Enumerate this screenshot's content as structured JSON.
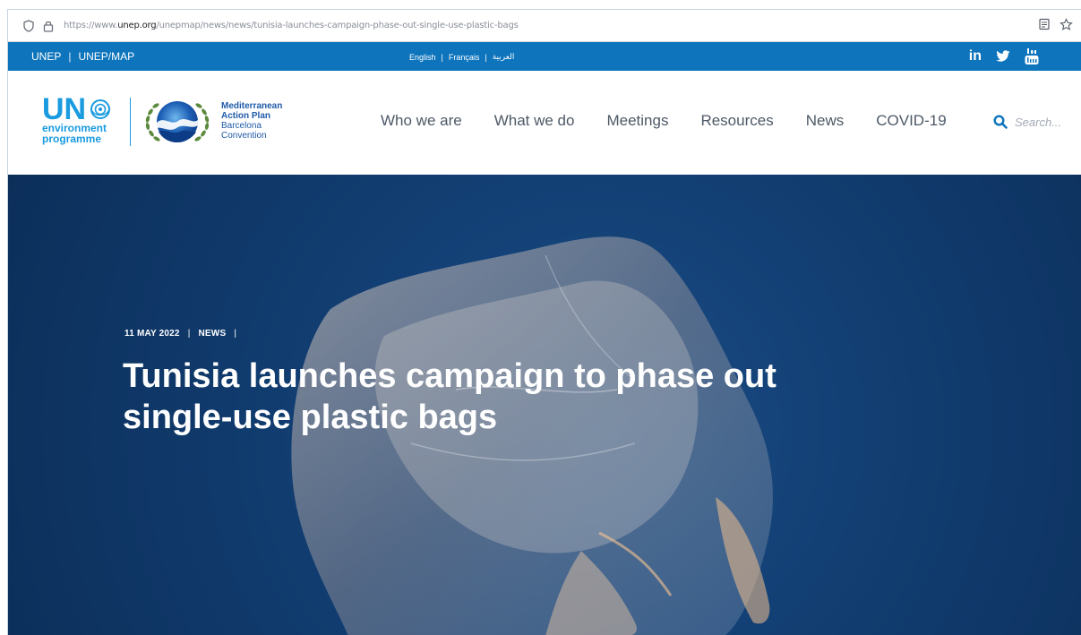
{
  "browser": {
    "url_prefix": "https://www.",
    "url_domain": "unep.org",
    "url_path": "/unepmap/news/news/tunisia-launches-campaign-phase-out-single-use-plastic-bags"
  },
  "utility_bar": {
    "links": [
      "UNEP",
      "UNEP/MAP"
    ],
    "languages": [
      "English",
      "Français",
      "العربية"
    ],
    "social": [
      {
        "icon": "linkedin-icon",
        "label": "in"
      },
      {
        "icon": "twitter-icon"
      },
      {
        "icon": "youtube-icon"
      }
    ]
  },
  "header": {
    "unep_logo": {
      "mark": "UN",
      "lines": [
        "environment",
        "programme"
      ]
    },
    "map_logo": {
      "lines": [
        "Mediterranean",
        "Action Plan",
        "Barcelona",
        "Convention"
      ]
    },
    "nav": [
      "Who we are",
      "What we do",
      "Meetings",
      "Resources",
      "News",
      "COVID-19"
    ],
    "search_placeholder": "Search..."
  },
  "article": {
    "date": "11 MAY 2022",
    "category": "NEWS",
    "title": "Tunisia launches campaign to phase out single-use plastic bags"
  },
  "colors": {
    "utility_bar": "#0e74bc",
    "unep_blue": "#1a9be0",
    "hero_background": "#123f74"
  }
}
